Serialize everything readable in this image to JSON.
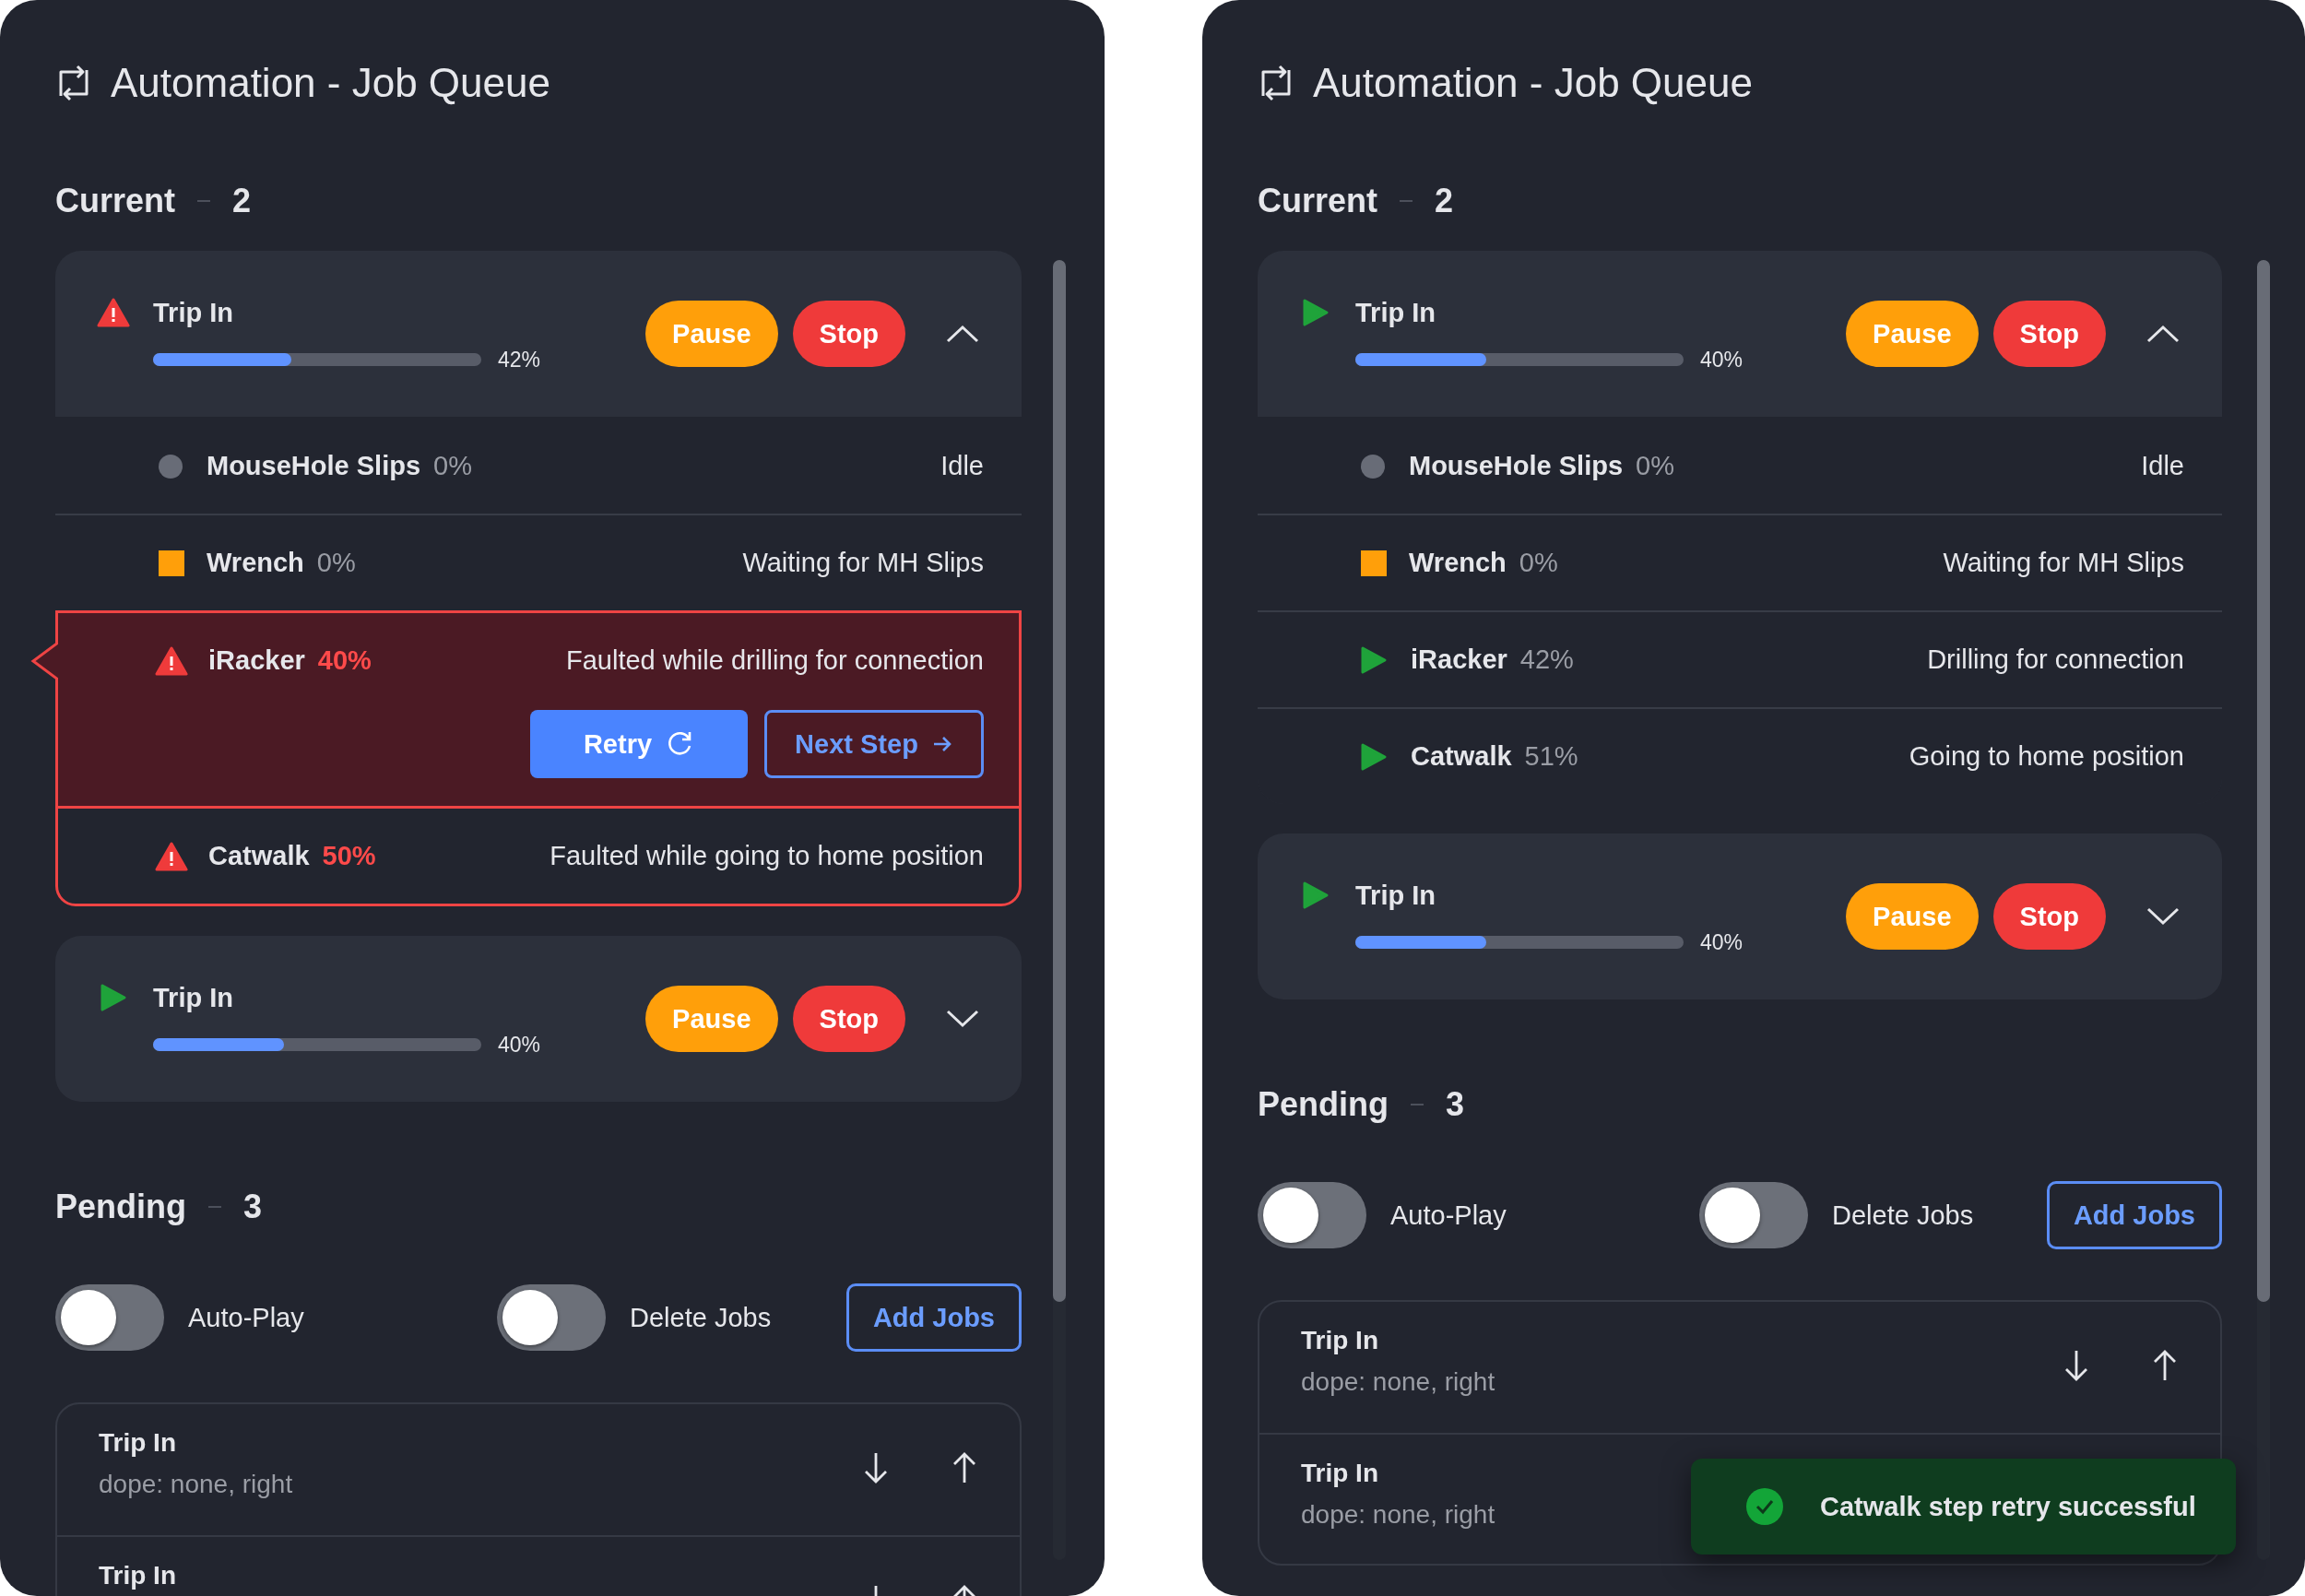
{
  "panels": [
    {
      "title": "Automation - Job Queue",
      "current": {
        "label": "Current",
        "count": "2",
        "jobs": [
          {
            "kind": "fault",
            "name": "Trip In",
            "level": 0.42,
            "percent": "42%",
            "expanded": true,
            "buttons": [
              "Pause",
              "Stop"
            ],
            "steps": [
              {
                "kind": "idle",
                "name": "MouseHole Slips",
                "percent": "0%",
                "message": "Idle",
                "selected": false
              },
              {
                "kind": "waiting",
                "name": "Wrench",
                "percent": "0%",
                "message": "Waiting for MH Slips",
                "selected": false
              },
              {
                "kind": "fault",
                "name": "iRacker",
                "percent": "40%",
                "message": "Faulted while drilling for connection",
                "selected": true,
                "actions": [
                  {
                    "kind": "retry",
                    "label": "Retry"
                  },
                  {
                    "kind": "next",
                    "label": "Next Step"
                  }
                ]
              },
              {
                "kind": "fault",
                "name": "Catwalk",
                "percent": "50%",
                "message": "Faulted while going to home position",
                "selected": false
              }
            ]
          },
          {
            "kind": "running",
            "name": "Trip In",
            "level": 0.4,
            "percent": "40%",
            "expanded": false,
            "buttons": [
              "Pause",
              "Stop"
            ]
          }
        ]
      },
      "pending": {
        "label": "Pending",
        "count": "3",
        "toggles": [
          {
            "label": "Auto-Play",
            "on": false
          },
          {
            "label": "Delete Jobs",
            "on": false
          }
        ],
        "add_button": "Add Jobs",
        "jobs": [
          {
            "name": "Trip In",
            "detail": "dope: none, right",
            "arrows": true
          },
          {
            "name": "Trip In",
            "arrows": true
          }
        ]
      }
    },
    {
      "title": "Automation - Job Queue",
      "current": {
        "label": "Current",
        "count": "2",
        "jobs": [
          {
            "kind": "running",
            "name": "Trip In",
            "level": 0.4,
            "percent": "40%",
            "expanded": true,
            "buttons": [
              "Pause",
              "Stop"
            ],
            "steps": [
              {
                "kind": "idle",
                "name": "MouseHole Slips",
                "percent": "0%",
                "message": "Idle",
                "selected": false
              },
              {
                "kind": "waiting",
                "name": "Wrench",
                "percent": "0%",
                "message": "Waiting for MH Slips",
                "selected": false
              },
              {
                "kind": "running",
                "name": "iRacker",
                "percent": "42%",
                "message": "Drilling for connection",
                "selected": false
              },
              {
                "kind": "running",
                "name": "Catwalk",
                "percent": "51%",
                "message": "Going to home position",
                "selected": false
              }
            ]
          },
          {
            "kind": "running",
            "name": "Trip In",
            "level": 0.4,
            "percent": "40%",
            "expanded": false,
            "buttons": [
              "Pause",
              "Stop"
            ]
          }
        ]
      },
      "pending": {
        "label": "Pending",
        "count": "3",
        "toggles": [
          {
            "label": "Auto-Play",
            "on": false
          },
          {
            "label": "Delete Jobs",
            "on": false
          }
        ],
        "add_button": "Add Jobs",
        "jobs": [
          {
            "name": "Trip In",
            "detail": "dope: none, right",
            "arrows": true
          },
          {
            "name": "Trip In",
            "detail": "dope: none, right",
            "arrows": false
          }
        ]
      },
      "toast": {
        "message": "Catwalk step retry successful"
      }
    }
  ]
}
